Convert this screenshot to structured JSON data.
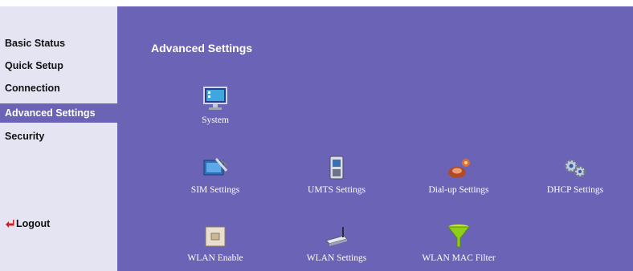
{
  "sidebar": {
    "items": [
      {
        "label": "Basic Status"
      },
      {
        "label": "Quick Setup"
      },
      {
        "label": "Connection"
      },
      {
        "label": "Advanced Settings"
      },
      {
        "label": "Security"
      }
    ],
    "active_item": "Advanced Settings",
    "logout_label": "Logout"
  },
  "main": {
    "title": "Advanced Settings",
    "tiles": [
      {
        "label": "System",
        "icon": "monitor-icon"
      },
      {
        "label": "SIM Settings",
        "icon": "sim-card-icon"
      },
      {
        "label": "UMTS Settings",
        "icon": "phone-icon"
      },
      {
        "label": "Dial-up Settings",
        "icon": "dialup-icon"
      },
      {
        "label": "DHCP Settings",
        "icon": "gears-icon"
      },
      {
        "label": "WLAN Enable",
        "icon": "switch-icon"
      },
      {
        "label": "WLAN Settings",
        "icon": "router-icon"
      },
      {
        "label": "WLAN MAC Filter",
        "icon": "funnel-icon"
      }
    ]
  },
  "colors": {
    "sidebar_bg": "#e4e4f2",
    "main_bg": "#6b63b5",
    "active_bg": "#6b63b5",
    "text_light": "#ffffff",
    "logout_arrow": "#cc2222"
  }
}
